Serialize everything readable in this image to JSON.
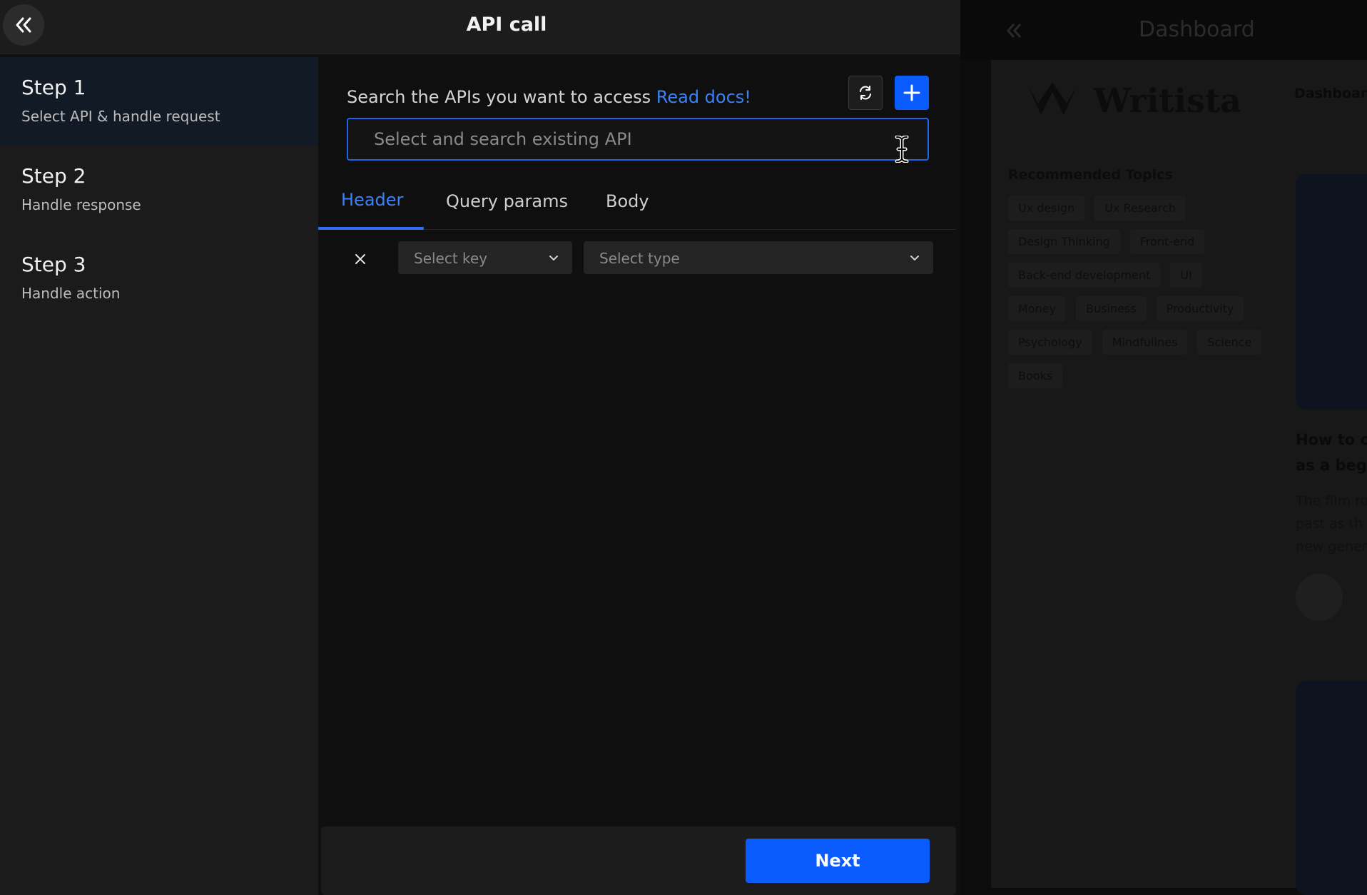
{
  "modal": {
    "title": "API call",
    "steps": [
      {
        "title": "Step 1",
        "desc": "Select API & handle request"
      },
      {
        "title": "Step 2",
        "desc": "Handle response"
      },
      {
        "title": "Step 3",
        "desc": "Handle action"
      }
    ],
    "search": {
      "label": "Search the APIs you want to access",
      "docs_link": "Read docs!",
      "placeholder": "Select and search existing API"
    },
    "tabs": [
      {
        "label": "Header"
      },
      {
        "label": "Query params"
      },
      {
        "label": "Body"
      }
    ],
    "param_row": {
      "key_placeholder": "Select key",
      "type_placeholder": "Select type"
    },
    "next_label": "Next"
  },
  "background": {
    "title": "Dashboard",
    "logo_text": "Writista",
    "nav_item": "Dashboard",
    "topics_title": "Recommended Topics",
    "topics": [
      "Ux design",
      "Ux Research",
      "Design Thinking",
      "Front-end",
      "Back-end development",
      "UI",
      "Money",
      "Business",
      "Productivity",
      "Psychology",
      "Mindfullnes",
      "Science",
      "Books"
    ],
    "card_title": "How to cr\nas a begi",
    "card_text": "The film ro\npast as th\nnew gener"
  },
  "colors": {
    "accent": "#0b5cff",
    "link": "#3b82f6",
    "active_step_bg": "#121a26"
  }
}
